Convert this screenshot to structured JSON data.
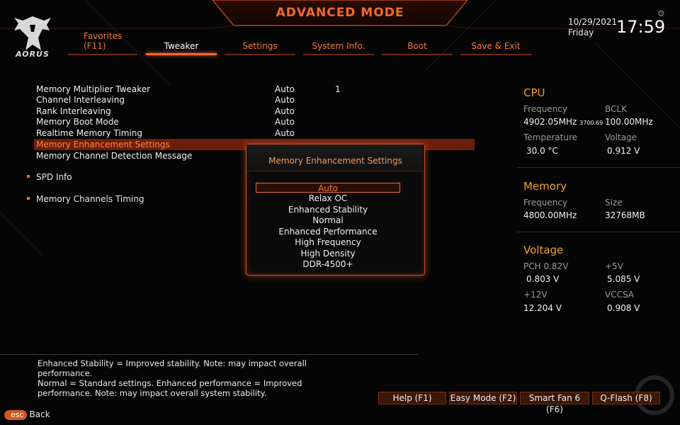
{
  "header": {
    "title": "ADVANCED MODE",
    "logo_text": "AORUS",
    "date": "10/29/2021",
    "day": "Friday",
    "time": "17:59"
  },
  "tabs": [
    {
      "label": "Favorites\n(F11)"
    },
    {
      "label": "Tweaker"
    },
    {
      "label": "Settings"
    },
    {
      "label": "System Info."
    },
    {
      "label": "Boot"
    },
    {
      "label": "Save & Exit"
    }
  ],
  "settings": [
    {
      "label": "Memory Multiplier Tweaker",
      "value": "Auto",
      "value2": "1"
    },
    {
      "label": "Channel Interleaving",
      "value": "Auto"
    },
    {
      "label": "Rank Interleaving",
      "value": "Auto"
    },
    {
      "label": "Memory Boot Mode",
      "value": "Auto"
    },
    {
      "label": "Realtime Memory Timing",
      "value": "Auto"
    },
    {
      "label": "Memory Enhancement Settings"
    },
    {
      "label": "Memory Channel Detection Message"
    }
  ],
  "submenus": [
    {
      "label": "SPD Info"
    },
    {
      "label": "Memory Channels Timing"
    }
  ],
  "popup": {
    "title": "Memory Enhancement Settings",
    "options": [
      "Auto",
      "Relax OC",
      "Enhanced Stability",
      "Normal",
      "Enhanced Performance",
      "High Frequency",
      "High Density",
      "DDR-4500+"
    ],
    "selected": "Auto"
  },
  "cpu": {
    "heading": "CPU",
    "frequency_label": "Frequency",
    "frequency": "4902.05MHz",
    "frequency_sub": "3700.69",
    "bclk_label": "BCLK",
    "bclk": "100.00MHz",
    "temperature_label": "Temperature",
    "temperature": "30.0 °C",
    "voltage_label": "Voltage",
    "voltage": "0.912 V"
  },
  "memory": {
    "heading": "Memory",
    "frequency_label": "Frequency",
    "frequency": "4800.00MHz",
    "size_label": "Size",
    "size": "32768MB"
  },
  "voltage": {
    "heading": "Voltage",
    "pch_label": "PCH 0.82V",
    "pch": "0.803 V",
    "p5v_label": "+5V",
    "p5v": "5.085 V",
    "p12v_label": "+12V",
    "p12v": "12.204 V",
    "vccsa_label": "VCCSA",
    "vccsa": "0.908 V"
  },
  "help_text": "Enhanced Stability = Improved stability. Note: may impact overall performance.\nNormal = Standard settings. Enhanced performance = Improved performance. Note: may impact overall system stability.",
  "footer": {
    "help": "Help (F1)",
    "easy_mode": "Easy Mode (F2)",
    "smart_fan": "Smart Fan 6 (F6)",
    "qflash": "Q-Flash (F8)",
    "esc": "esc",
    "back": "Back"
  },
  "colors": {
    "accent": "#f26a2e",
    "heading": "#f5a025",
    "selected_bg": "#6d1d0b"
  }
}
